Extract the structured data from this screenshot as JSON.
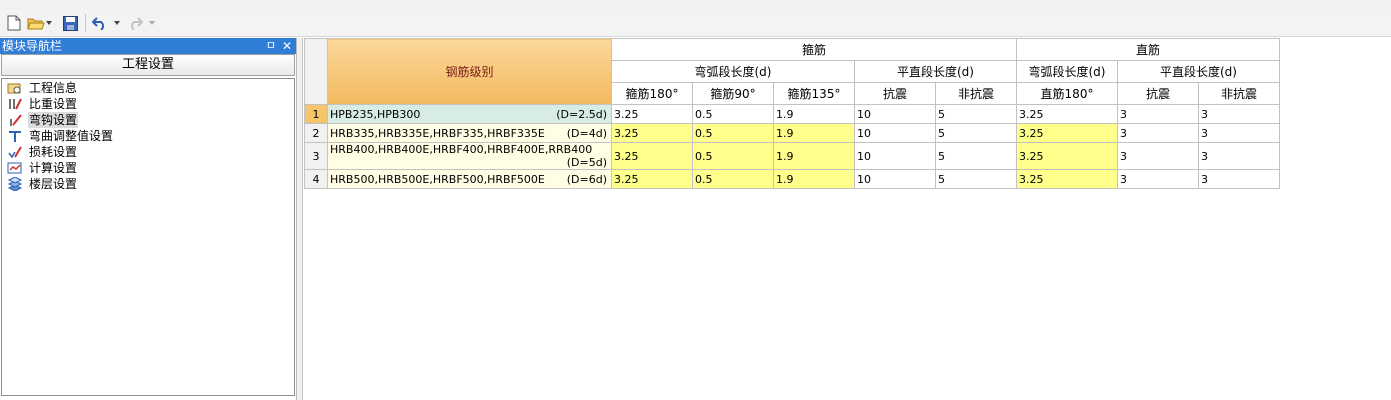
{
  "panel": {
    "title": "模块导航栏",
    "pin_glyph": "ㅁ",
    "close_glyph": "✕",
    "section_header": "工程设置",
    "items": [
      {
        "label": "工程信息",
        "icon": "project-info-icon"
      },
      {
        "label": "比重设置",
        "icon": "density-settings-icon"
      },
      {
        "label": "弯钩设置",
        "icon": "hook-settings-icon",
        "selected": true
      },
      {
        "label": "弯曲调整值设置",
        "icon": "bend-adjust-icon"
      },
      {
        "label": "损耗设置",
        "icon": "loss-settings-icon"
      },
      {
        "label": "计算设置",
        "icon": "calc-settings-icon"
      },
      {
        "label": "楼层设置",
        "icon": "floor-settings-icon"
      }
    ]
  },
  "grid": {
    "header_grade": "钢筋级别",
    "group_stirrup": "箍筋",
    "group_straight": "直筋",
    "sub_arc": "弯弧段长度(d)",
    "sub_flat": "平直段长度(d)",
    "sub_arc2": "弯弧段长度(d)",
    "sub_flat2": "平直段长度(d)",
    "cols": [
      "箍筋180°",
      "箍筋90°",
      "箍筋135°",
      "抗震",
      "非抗震",
      "直筋180°",
      "抗震",
      "非抗震"
    ],
    "rows": [
      {
        "n": "1",
        "grade": "HPB235,HPB300",
        "d": "(D=2.5d)",
        "v": [
          "3.25",
          "0.5",
          "1.9",
          "10",
          "5",
          "3.25",
          "3",
          "3"
        ]
      },
      {
        "n": "2",
        "grade": "HRB335,HRB335E,HRBF335,HRBF335E",
        "d": "(D=4d)",
        "v": [
          "3.25",
          "0.5",
          "1.9",
          "10",
          "5",
          "3.25",
          "3",
          "3"
        ]
      },
      {
        "n": "3",
        "grade": "HRB400,HRB400E,HRBF400,HRBF400E,RRB400",
        "d": "(D=5d)",
        "v": [
          "3.25",
          "0.5",
          "1.9",
          "10",
          "5",
          "3.25",
          "3",
          "3"
        ]
      },
      {
        "n": "4",
        "grade": "HRB500,HRB500E,HRBF500,HRBF500E",
        "d": "(D=6d)",
        "v": [
          "3.25",
          "0.5",
          "1.9",
          "10",
          "5",
          "3.25",
          "3",
          "3"
        ]
      }
    ]
  },
  "colors": {
    "panel_title_bg": "#2f7dd6",
    "grade_header": "#f2b95d",
    "editable_cell": "#ffff8c",
    "grade_cell": "#fffde4",
    "selected_grade_cell": "#d7ede4"
  }
}
